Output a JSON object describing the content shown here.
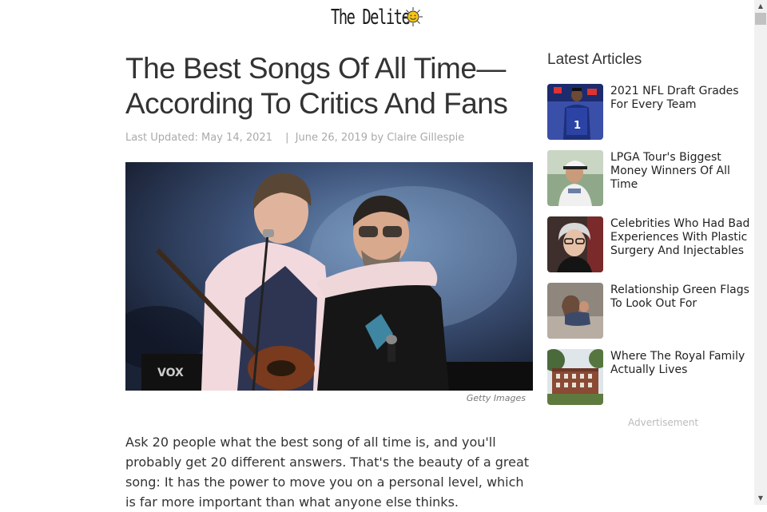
{
  "header": {
    "logo_text": "The Delite"
  },
  "article": {
    "title": "The Best Songs Of All Time—According To Critics And Fans",
    "meta": {
      "updated": "Last Updated: May 14, 2021",
      "separator": "|",
      "published": "June 26, 2019",
      "by": "by",
      "author": "Claire Gillespie"
    },
    "image_caption": "Getty Images",
    "body": "Ask 20 people what the best song of all time is, and you'll probably get 20 different answers. That's the beauty of a great song: It has the power to move you on a personal level, which is far more important than what anyone else thinks."
  },
  "sidebar": {
    "title": "Latest Articles",
    "items": [
      {
        "label": "2021 NFL Draft Grades For Every Team",
        "icon": "nfl-draft-photo"
      },
      {
        "label": "LPGA Tour's Biggest Money Winners Of All Time",
        "icon": "golfer-photo"
      },
      {
        "label": "Celebrities Who Had Bad Experiences With Plastic Surgery And Injectables",
        "icon": "celebrity-photo"
      },
      {
        "label": "Relationship Green Flags To Look Out For",
        "icon": "couple-photo"
      },
      {
        "label": "Where The Royal Family Actually Lives",
        "icon": "palace-photo"
      }
    ],
    "advertisement": "Advertisement"
  },
  "colors": {
    "text": "#333333",
    "meta": "#aaaaaa",
    "accent_sun": "#f5c518"
  }
}
